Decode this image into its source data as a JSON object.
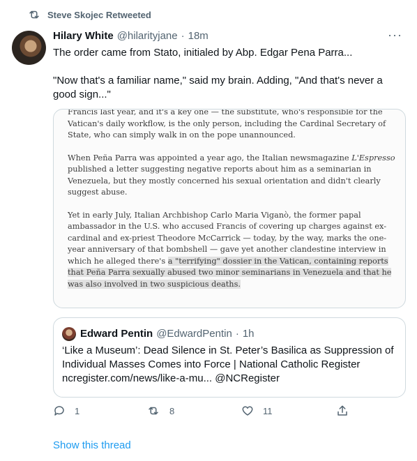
{
  "retweet": {
    "label": "Steve Skojec Retweeted",
    "icon": "retweet-icon"
  },
  "tweet": {
    "author_name": "Hilary White",
    "author_handle": "@hilarityjane",
    "separator": "·",
    "time": "18m",
    "more_icon": "more-icon",
    "text_line1": "The order came from Stato, initialed by Abp. Edgar Pena Parra...",
    "text_line2": "\"Now that's a familiar name,\" said my brain. Adding, \"And that's never a good sign...\""
  },
  "media": {
    "para1": "Francis last year, and it's a key one — the substitute, who's responsible for the Vatican's daily workflow, is the only person, including the Cardinal Secretary of State, who can simply walk in on the pope unannounced.",
    "para2_pre": "When Peña Parra was appointed a year ago, the Italian newsmagazine ",
    "para2_em": "L'Espresso",
    "para2_post": " published a letter suggesting negative reports about him as a seminarian in Venezuela, but they mostly concerned his sexual orientation and didn't clearly suggest abuse.",
    "para3_plain": "Yet in early July, Italian Archbishop Carlo Maria Viganò, the former papal ambassador in the U.S. who accused Francis of covering up charges against ex-cardinal and ex-priest Theodore McCarrick — today, by the way, marks the one-year anniversary of that bombshell — gave yet another clandestine interview in which he alleged there's ",
    "para3_highlight": "a \"terrifying\" dossier in the Vatican, containing reports that Peña Parra sexually abused two minor seminarians in Venezuela and that he was also involved in two suspicious deaths."
  },
  "quote": {
    "author_name": "Edward Pentin",
    "author_handle": "@EdwardPentin",
    "separator": "·",
    "time": "1h",
    "text": "‘Like a Museum’: Dead Silence in St. Peter’s Basilica as Suppression of Individual Masses Comes into Force | National Catholic Register",
    "link": "ncregister.com/news/like-a-mu... @NCRegister"
  },
  "actions": {
    "reply_count": "1",
    "retweet_count": "8",
    "like_count": "11"
  },
  "show_thread": "Show this thread",
  "colors": {
    "accent": "#1d9bf0",
    "muted": "#536471",
    "text": "#0f1419",
    "border": "#cfd9de"
  }
}
